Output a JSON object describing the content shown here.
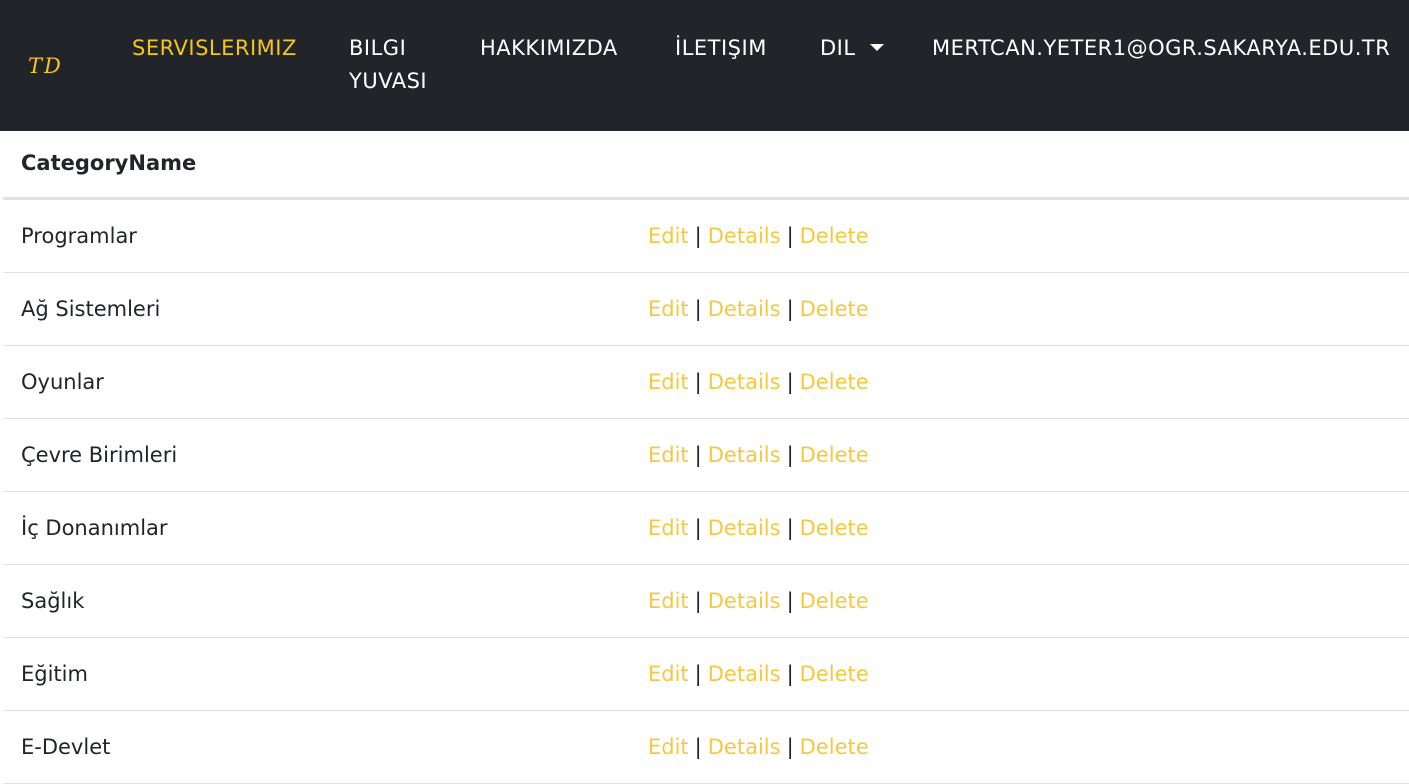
{
  "nav": {
    "brand": "TD",
    "services": "SERVISLERIMIZ",
    "knowledge": "BILGI YUVASI",
    "about": "HAKKIMIZDA",
    "contact": "İLETIŞIM",
    "language": "DIL",
    "user": "MERTCAN.YETER1@OGR.SAKARYA.EDU.TR"
  },
  "table": {
    "header": "CategoryName",
    "actions": {
      "edit": "Edit",
      "details": "Details",
      "delete": "Delete",
      "separator": "|"
    },
    "rows": [
      {
        "name": "Programlar"
      },
      {
        "name": "Ağ Sistemleri"
      },
      {
        "name": "Oyunlar"
      },
      {
        "name": "Çevre Birimleri"
      },
      {
        "name": "İç Donanımlar"
      },
      {
        "name": "Sağlık"
      },
      {
        "name": "Eğitim"
      },
      {
        "name": "E-Devlet"
      }
    ]
  }
}
